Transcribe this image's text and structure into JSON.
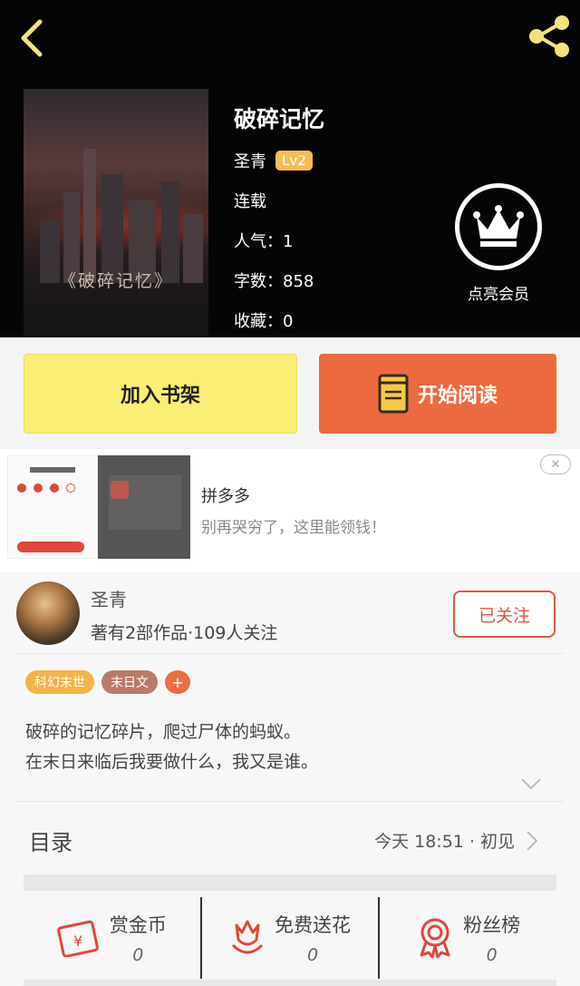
{
  "header": {
    "book_title": "破碎记忆",
    "cover_title": "《破碎记忆》",
    "author": "圣青",
    "author_level": "Lv2",
    "status": "连载",
    "popularity": "人气：1",
    "word_count": "字数：858",
    "collections": "收藏：0",
    "vip_label": "点亮会员"
  },
  "actions": {
    "add_shelf": "加入书架",
    "start_read": "开始阅读"
  },
  "ad": {
    "title": "拼多多",
    "desc": "别再哭穷了，这里能领钱！",
    "close": "✕"
  },
  "author_block": {
    "name": "圣青",
    "stats": "著有2部作品·109人关注",
    "follow": "已关注"
  },
  "tags": [
    {
      "label": "科幻末世",
      "color": "#f3b24a"
    },
    {
      "label": "末日文",
      "color": "#b97a69"
    },
    {
      "label": "+",
      "color": "#ea6d43"
    }
  ],
  "synopsis": {
    "line1": "破碎的记忆碎片，爬过尸体的蚂蚁。",
    "line2": "在末日来临后我要做什么，我又是谁。"
  },
  "toc": {
    "label": "目录",
    "latest": "今天 18:51 · 初见"
  },
  "stats": [
    {
      "label": "赏金币",
      "count": "0",
      "icon": "red-envelope-icon"
    },
    {
      "label": "免费送花",
      "count": "0",
      "icon": "flower-icon"
    },
    {
      "label": "粉丝榜",
      "count": "0",
      "icon": "medal-icon"
    }
  ],
  "colors": {
    "accent": "#ec6a3f",
    "shelf_yellow": "#fbee75",
    "icon_yellow": "#f1e47a",
    "follow_red": "#e2563c"
  }
}
